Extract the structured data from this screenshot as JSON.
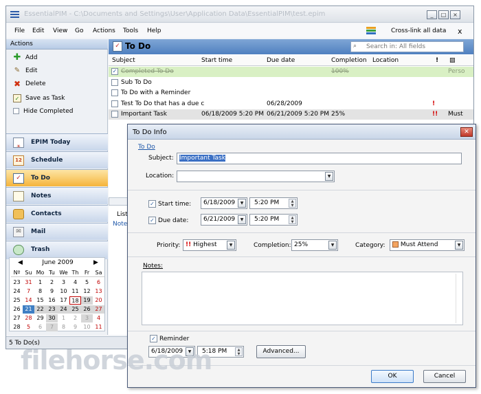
{
  "window": {
    "title": "EssentialPIM - C:\\Documents and Settings\\User\\Application Data\\EssentialPIM\\test.epim",
    "controls": [
      "_",
      "□",
      "×"
    ]
  },
  "menu": {
    "items": [
      "File",
      "Edit",
      "View",
      "Go",
      "Actions",
      "Tools",
      "Help"
    ],
    "crosslink": "Cross-link all data",
    "close": "x"
  },
  "sidebar": {
    "actions_header": "Actions",
    "actions": [
      {
        "label": "Add",
        "icon": "plus-icon"
      },
      {
        "label": "Edit",
        "icon": "pencil-icon"
      },
      {
        "label": "Delete",
        "icon": "delete-x-icon"
      },
      {
        "label": "Save as Task",
        "icon": "task-icon"
      },
      {
        "label": "Hide Completed",
        "icon": "checkbox"
      }
    ],
    "nav": [
      {
        "label": "EPIM Today",
        "icon": "today-icon"
      },
      {
        "label": "Schedule",
        "icon": "calendar-icon"
      },
      {
        "label": "To Do",
        "icon": "todo-icon",
        "active": true
      },
      {
        "label": "Notes",
        "icon": "notes-icon"
      },
      {
        "label": "Contacts",
        "icon": "contacts-icon"
      },
      {
        "label": "Mail",
        "icon": "mail-icon"
      },
      {
        "label": "Trash",
        "icon": "trash-icon"
      }
    ],
    "calendar": {
      "month": "June  2009",
      "headers": [
        "Nº",
        "Su",
        "Mo",
        "Tu",
        "We",
        "Th",
        "Fr",
        "Sa"
      ],
      "weeks": [
        [
          "23",
          "31",
          "1",
          "2",
          "3",
          "4",
          "5",
          "6"
        ],
        [
          "24",
          "7",
          "8",
          "9",
          "10",
          "11",
          "12",
          "13"
        ],
        [
          "25",
          "14",
          "15",
          "16",
          "17",
          "18",
          "19",
          "20"
        ],
        [
          "26",
          "21",
          "22",
          "23",
          "24",
          "25",
          "26",
          "27"
        ],
        [
          "27",
          "28",
          "29",
          "30",
          "1",
          "2",
          "3",
          "4"
        ],
        [
          "28",
          "5",
          "6",
          "7",
          "8",
          "9",
          "10",
          "11"
        ]
      ]
    }
  },
  "status": {
    "text": "5 To Do(s)"
  },
  "todo": {
    "title": "To Do",
    "search_placeholder": "Search in: All fields",
    "columns": [
      "Subject",
      "Start time",
      "Due date",
      "Completion",
      "Location",
      "!",
      "▨"
    ],
    "rows": [
      {
        "subject": "Completed To Do",
        "start": "",
        "due": "",
        "completion": "100%",
        "priority": "",
        "category": "Perso",
        "checked": true,
        "completed": true
      },
      {
        "subject": "Sub To Do",
        "start": "",
        "due": "",
        "completion": "",
        "priority": "",
        "category": "",
        "checked": false
      },
      {
        "subject": "To Do with a Reminder",
        "start": "",
        "due": "",
        "completion": "",
        "priority": "",
        "category": "",
        "checked": false
      },
      {
        "subject": "Test To Do that has a due c",
        "start": "",
        "due": "06/28/2009",
        "completion": "",
        "priority": "!",
        "category": "",
        "checked": false
      },
      {
        "subject": "Important Task",
        "start": "06/18/2009 5:20 PM",
        "due": "06/21/2009 5:20 PM",
        "completion": "25%",
        "priority": "!!",
        "category": "Must",
        "checked": false,
        "selected": true
      }
    ],
    "lower_tabs": [
      "List",
      "Notes"
    ]
  },
  "dialog": {
    "title": "To Do Info",
    "breadcrumb": "To Do",
    "subject_label": "Subject:",
    "subject_value": "Important Task",
    "location_label": "Location:",
    "location_value": "",
    "start_label": "Start time:",
    "start_date": "6/18/2009",
    "start_time": "5:20 PM",
    "due_label": "Due date:",
    "due_date": "6/21/2009",
    "due_time": "5:20 PM",
    "priority_label": "Priority:",
    "priority_value": "Highest",
    "completion_label": "Completion:",
    "completion_value": "25%",
    "category_label": "Category:",
    "category_value": "Must Attend",
    "notes_label": "Notes:",
    "reminder_label": "Reminder",
    "reminder_date": "6/18/2009",
    "reminder_time": "5:18 PM",
    "advanced_label": "Advanced...",
    "ok_label": "OK",
    "cancel_label": "Cancel",
    "close_glyph": "✕"
  },
  "watermark": {
    "text": "filehorse.com"
  },
  "colors": {
    "accent": "#4f80c0",
    "active_nav": "#f5b43b",
    "priority": "#d40000",
    "category": "#f4a460"
  }
}
